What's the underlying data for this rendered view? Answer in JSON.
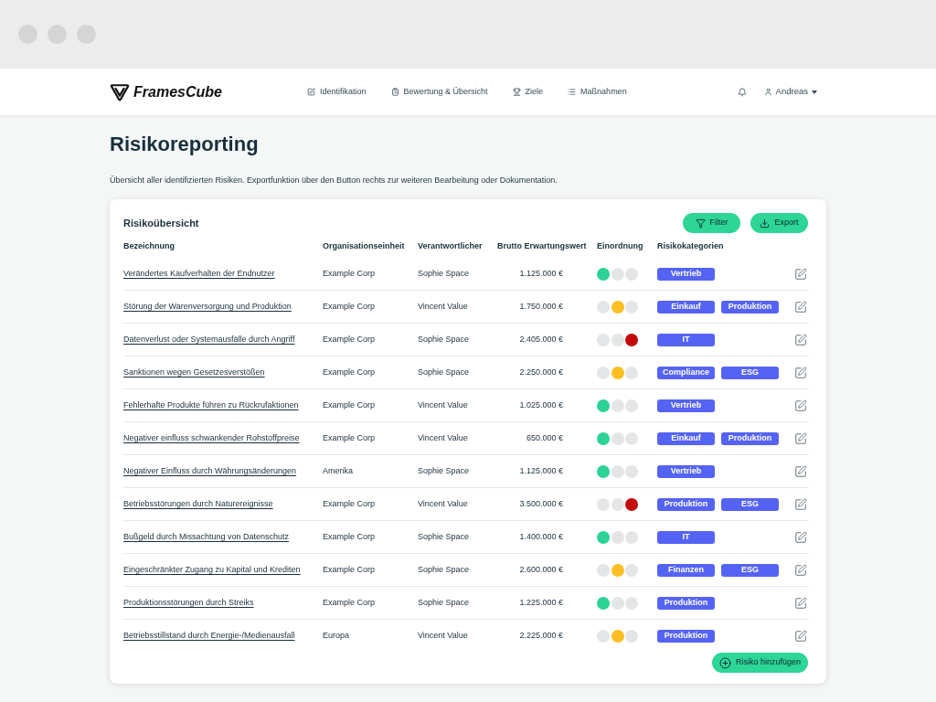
{
  "header": {
    "logo": "FramesCube",
    "nav": [
      {
        "label": "Identifikation"
      },
      {
        "label": "Bewertung & Übersicht"
      },
      {
        "label": "Ziele"
      },
      {
        "label": "Maßnahmen"
      }
    ],
    "user": "Andreas"
  },
  "page": {
    "title": "Risikoreporting",
    "description": "Übersicht aller identifizierten Risiken. Exportfunktion über den Button rechts zur weiteren Bearbeitung oder Dokumentation."
  },
  "table": {
    "title": "Risikoübersicht",
    "buttons": [
      "Filter",
      "Export"
    ],
    "columns": [
      "Bezeichnung",
      "Organisationseinheit",
      "Verantwortlicher",
      "Brutto Erwartungswert",
      "Einordnung",
      "Risikokategorien"
    ],
    "rows": [
      {
        "name": "Verändertes Kaufverhalten der Endnutzer",
        "unit": "Example Corp",
        "owner": "Sophie Space",
        "value": "1.125.000 €",
        "lights": [
          {
            "on": true
          },
          {
            "on": false
          },
          {
            "on": false
          }
        ],
        "categories": [
          "Vertrieb"
        ]
      },
      {
        "name": "Störung der Warenversorgung und Produktion",
        "unit": "Example Corp",
        "owner": "Vincent Value",
        "value": "1.750.000 €",
        "lights": [
          {
            "on": false
          },
          {
            "on": true
          },
          {
            "on": false
          }
        ],
        "categories": [
          "Einkauf",
          "Produktion"
        ]
      },
      {
        "name": "Datenverlust oder Systemausfälle durch Angriff",
        "unit": "Example Corp",
        "owner": "Sophie Space",
        "value": "2.405.000 €",
        "lights": [
          {
            "on": false
          },
          {
            "on": false
          },
          {
            "on": true
          }
        ],
        "categories": [
          "IT"
        ]
      },
      {
        "name": "Sanktionen wegen Gesetzesverstößen",
        "unit": "Example Corp",
        "owner": "Sophie Space",
        "value": "2.250.000 €",
        "lights": [
          {
            "on": false
          },
          {
            "on": true
          },
          {
            "on": false
          }
        ],
        "categories": [
          "Compliance",
          "ESG"
        ]
      },
      {
        "name": "Fehlerhafte Produkte führen zu Rückrufaktionen",
        "unit": "Example Corp",
        "owner": "Vincent Value",
        "value": "1.025.000 €",
        "lights": [
          {
            "on": true
          },
          {
            "on": false
          },
          {
            "on": false
          }
        ],
        "categories": [
          "Vertrieb"
        ]
      },
      {
        "name": "Negativer einfluss schwankender Rohstoffpreise",
        "unit": "Example Corp",
        "owner": "Vincent Value",
        "value": "650.000 €",
        "lights": [
          {
            "on": true
          },
          {
            "on": false
          },
          {
            "on": false
          }
        ],
        "categories": [
          "Einkauf",
          "Produktion"
        ]
      },
      {
        "name": "Negativer Einfluss durch Währungsänderungen",
        "unit": "Amerika",
        "owner": "Sophie Space",
        "value": "1.125.000 €",
        "lights": [
          {
            "on": true
          },
          {
            "on": false
          },
          {
            "on": false
          }
        ],
        "categories": [
          "Vertrieb"
        ]
      },
      {
        "name": "Betriebsstörungen durch Naturereignisse",
        "unit": "Example Corp",
        "owner": "Vincent Value",
        "value": "3.500.000 €",
        "lights": [
          {
            "on": false
          },
          {
            "on": false
          },
          {
            "on": true
          }
        ],
        "categories": [
          "Produktion",
          "ESG"
        ]
      },
      {
        "name": "Bußgeld durch Missachtung von Datenschutz",
        "unit": "Example Corp",
        "owner": "Sophie Space",
        "value": "1.400.000 €",
        "lights": [
          {
            "on": true
          },
          {
            "on": false
          },
          {
            "on": false
          }
        ],
        "categories": [
          "IT"
        ]
      },
      {
        "name": "Eingeschränkter Zugang zu Kapital und Krediten",
        "unit": "Example Corp",
        "owner": "Sophie Space",
        "value": "2.600.000 €",
        "lights": [
          {
            "on": false
          },
          {
            "on": true
          },
          {
            "on": false
          }
        ],
        "categories": [
          "Finanzen",
          "ESG"
        ]
      },
      {
        "name": "Produktionsstörungen durch Streiks",
        "unit": "Example Corp",
        "owner": "Sophie Space",
        "value": "1.225.000 €",
        "lights": [
          {
            "on": true
          },
          {
            "on": false
          },
          {
            "on": false
          }
        ],
        "categories": [
          "Produktion"
        ]
      },
      {
        "name": "Betriebsstillstand durch Energie-/Medienausfall",
        "unit": "Europa",
        "owner": "Vincent Value",
        "value": "2.225.000 €",
        "lights": [
          {
            "on": false
          },
          {
            "on": true
          },
          {
            "on": false
          }
        ],
        "categories": [
          "Produktion"
        ]
      }
    ],
    "add_button": "Risiko hinzufügen"
  }
}
